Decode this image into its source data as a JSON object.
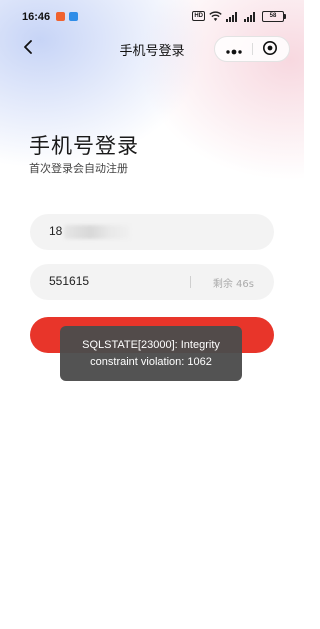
{
  "status_bar": {
    "time": "16:46",
    "network_badge": "HD",
    "battery_level": "58"
  },
  "nav": {
    "title": "手机号登录"
  },
  "header": {
    "title": "手机号登录",
    "subtitle": "首次登录会自动注册"
  },
  "form": {
    "phone_value": "18",
    "code_value": "551615",
    "countdown_text": "剩余 46s"
  },
  "toast": {
    "message": "SQLSTATE[23000]: Integrity constraint violation: 1062"
  },
  "colors": {
    "primary_button": "#e8352a",
    "toast_bg": "#4c4c4c",
    "field_bg": "#f3f3f3"
  },
  "icons": {
    "back": "chevron-left-icon",
    "more": "more-dots-icon",
    "close": "target-close-icon"
  }
}
